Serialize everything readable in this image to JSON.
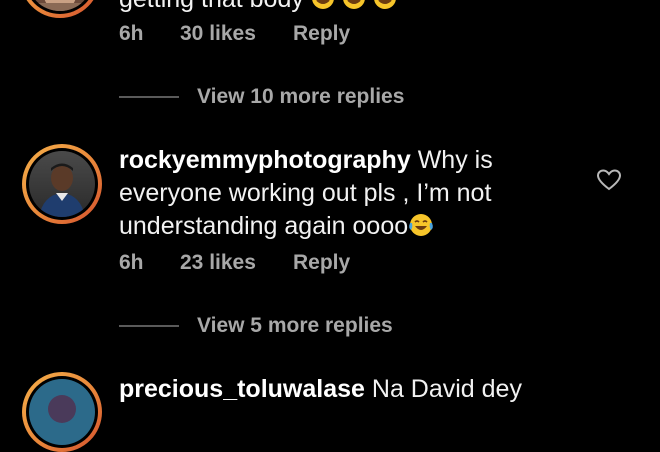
{
  "comment_top": {
    "text_fragment": "getting that body",
    "time": "6h",
    "likes": "30 likes",
    "reply": "Reply"
  },
  "replies_1": {
    "label": "View 10 more replies"
  },
  "comment_main": {
    "username": "rockyemmyphotography",
    "text_line1": " Why is",
    "text_line2": "everyone working out pls , I’m not",
    "text_line3": "understanding again oooo",
    "time": "6h",
    "likes": "23 likes",
    "reply": "Reply"
  },
  "replies_2": {
    "label": "View 5 more replies"
  },
  "comment_bottom": {
    "username": "precious_toluwalase",
    "text_fragment": " Na David dey"
  },
  "colors": {
    "background": "#000000",
    "text": "#f2f2f2",
    "meta": "#a8a8a8",
    "ring_start": "#f5b04a",
    "ring_end": "#d4502e"
  },
  "icons": {
    "like": "heart-outline-icon",
    "laugh": "tears-of-joy-emoji-icon",
    "grin": "grinning-emoji-icon"
  }
}
